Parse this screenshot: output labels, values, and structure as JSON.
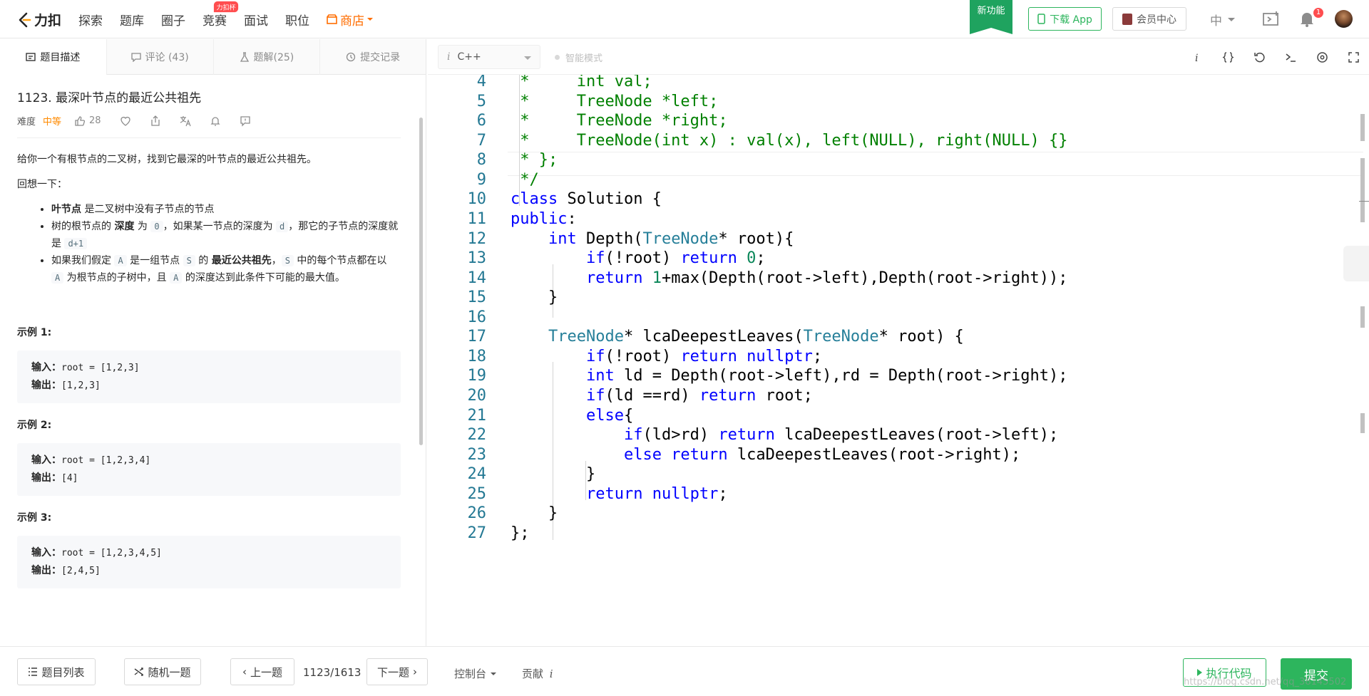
{
  "brand": {
    "name": "力扣",
    "accent": "#2db55d"
  },
  "nav": {
    "links": [
      "探索",
      "题库",
      "圈子",
      "竞赛",
      "面试",
      "职位"
    ],
    "contest_badge": "力扣杯",
    "shop": "商店",
    "new_feature": "新功能",
    "download_app": "下载 App",
    "member_center": "会员中心",
    "language": "中",
    "notification_count": "1"
  },
  "left_tabs": [
    {
      "label": "题目描述",
      "icon": "description-icon"
    },
    {
      "label": "评论 (43)",
      "icon": "comment-icon"
    },
    {
      "label": "题解(25)",
      "icon": "solution-icon"
    },
    {
      "label": "提交记录",
      "icon": "history-icon"
    }
  ],
  "problem": {
    "title": "1123. 最深叶节点的最近公共祖先",
    "difficulty_label": "难度",
    "difficulty": "中等",
    "likes": "28",
    "description": "给你一个有根节点的二叉树，找到它最深的叶节点的最近公共祖先。",
    "recall": "回想一下：",
    "definitions": {
      "d1": {
        "strong": "叶节点",
        "rest": " 是二叉树中没有子节点的节点"
      },
      "d2": {
        "a": "树的根节点的 ",
        "strong": "深度",
        "b": " 为 ",
        "c0": "0",
        "c": "，如果某一节点的深度为 ",
        "cd": "d",
        "d": "，那它的子节点的深度就是 ",
        "cd1": "d+1"
      },
      "d3": {
        "a": "如果我们假定 ",
        "cA": "A",
        "b": " 是一组节点 ",
        "cS": "S",
        "c": " 的 ",
        "strong": "最近公共祖先",
        "d": "，",
        "cS2": "S",
        "e": " 中的每个节点都在以 ",
        "cA2": "A",
        "f": " 为根节点的子树中，且 ",
        "cA3": "A",
        "g": " 的深度达到此条件下可能的最大值。"
      }
    },
    "examples": [
      {
        "title": "示例 1:",
        "input_label": "输入：",
        "input": "root = [1,2,3]",
        "output_label": "输出：",
        "output": "[1,2,3]"
      },
      {
        "title": "示例 2:",
        "input_label": "输入：",
        "input": "root = [1,2,3,4]",
        "output_label": "输出：",
        "output": "[4]"
      },
      {
        "title": "示例 3:",
        "input_label": "输入：",
        "input": "root = [1,2,3,4,5]",
        "output_label": "输出：",
        "output": "[2,4,5]"
      }
    ]
  },
  "editor": {
    "language": "C++",
    "language_icon": "i",
    "smart_mode": "智能模式",
    "toolbar_icons": [
      "info-icon",
      "braces-icon",
      "reset-icon",
      "terminal-icon",
      "settings-icon",
      "fullscreen-icon"
    ],
    "lines": [
      {
        "n": "4"
      },
      {
        "n": "5"
      },
      {
        "n": "6"
      },
      {
        "n": "7"
      },
      {
        "n": "8"
      },
      {
        "n": "9"
      },
      {
        "n": "10"
      },
      {
        "n": "11"
      },
      {
        "n": "12"
      },
      {
        "n": "13"
      },
      {
        "n": "14"
      },
      {
        "n": "15"
      },
      {
        "n": "16"
      },
      {
        "n": "17"
      },
      {
        "n": "18"
      },
      {
        "n": "19"
      },
      {
        "n": "20"
      },
      {
        "n": "21"
      },
      {
        "n": "22"
      },
      {
        "n": "23"
      },
      {
        "n": "24"
      },
      {
        "n": "25"
      },
      {
        "n": "26"
      },
      {
        "n": "27"
      }
    ]
  },
  "bottom": {
    "problem_list": "题目列表",
    "random": "随机一题",
    "prev": "上一题",
    "page": "1123/1613",
    "next": "下一题",
    "console": "控制台",
    "contribute": "贡献",
    "run": "执行代码",
    "submit": "提交",
    "watermark": "https://blog.csdn.net/qq_38145502"
  }
}
